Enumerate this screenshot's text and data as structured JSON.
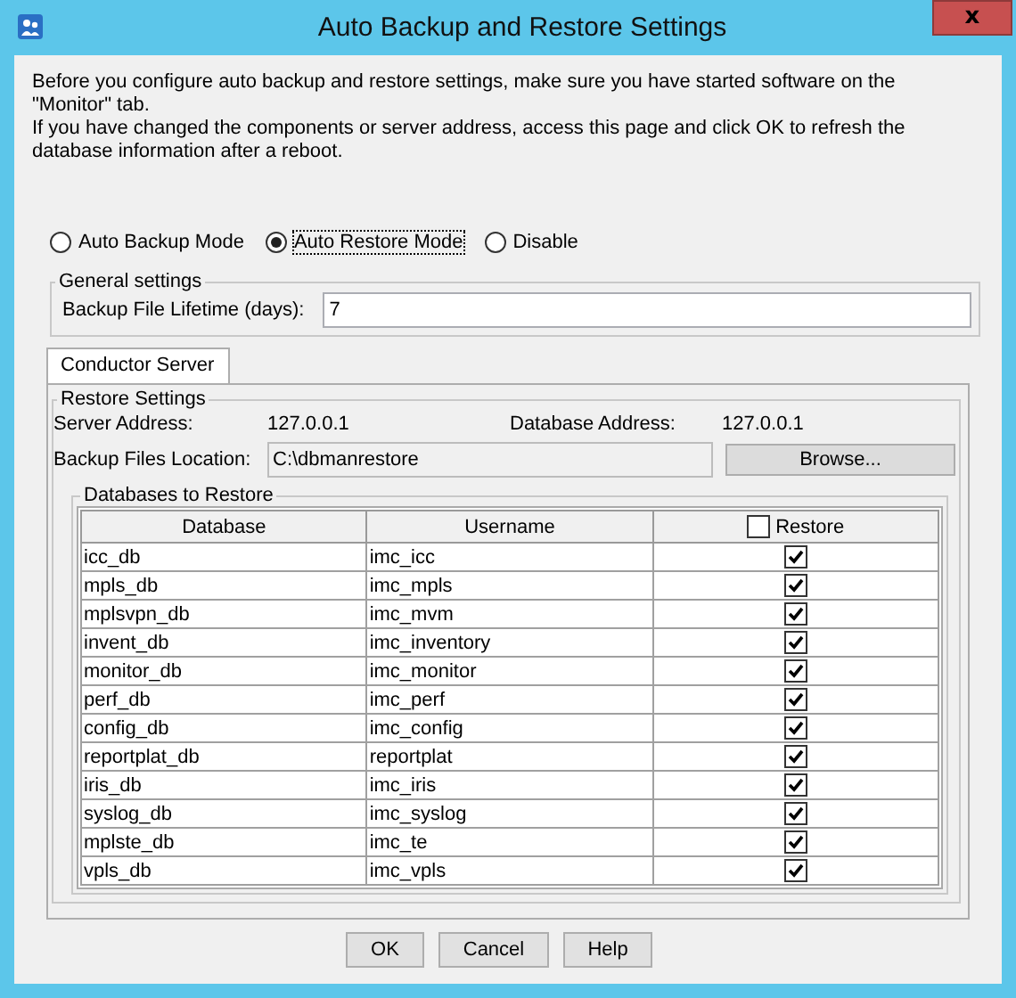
{
  "window": {
    "title": "Auto Backup and Restore Settings",
    "close": "x"
  },
  "intro": [
    "Before you configure auto backup and restore settings, make sure you have started software on the \"Monitor\" tab.",
    "If you have changed the components or server address, access this page and click OK to refresh the database information after a reboot."
  ],
  "modes": [
    {
      "label": "Auto Backup Mode",
      "selected": false
    },
    {
      "label": "Auto Restore Mode",
      "selected": true
    },
    {
      "label": "Disable",
      "selected": false
    }
  ],
  "general_settings": {
    "title": "General settings",
    "lifetime_label": "Backup File Lifetime (days):",
    "lifetime_value": "7"
  },
  "tabs": [
    {
      "label": "Conductor Server",
      "selected": true
    }
  ],
  "restore_settings": {
    "title": "Restore Settings",
    "server_address_label": "Server Address:",
    "server_address": "127.0.0.1",
    "database_address_label": "Database Address:",
    "database_address": "127.0.0.1",
    "location_label": "Backup Files Location:",
    "location_value": "C:\\dbmanrestore",
    "browse_button": "Browse..."
  },
  "databases": {
    "title": "Databases to Restore",
    "columns": [
      {
        "label": "Database",
        "kind": "text"
      },
      {
        "label": "Username",
        "kind": "text"
      },
      {
        "label": "Restore",
        "kind": "check",
        "checked": false
      }
    ],
    "rows": [
      {
        "database": "icc_db",
        "username": "imc_icc",
        "restore": true
      },
      {
        "database": "mpls_db",
        "username": "imc_mpls",
        "restore": true
      },
      {
        "database": "mplsvpn_db",
        "username": "imc_mvm",
        "restore": true
      },
      {
        "database": "invent_db",
        "username": "imc_inventory",
        "restore": true
      },
      {
        "database": "monitor_db",
        "username": "imc_monitor",
        "restore": true
      },
      {
        "database": "perf_db",
        "username": "imc_perf",
        "restore": true
      },
      {
        "database": "config_db",
        "username": "imc_config",
        "restore": true
      },
      {
        "database": "reportplat_db",
        "username": "reportplat",
        "restore": true
      },
      {
        "database": "iris_db",
        "username": "imc_iris",
        "restore": true
      },
      {
        "database": "syslog_db",
        "username": "imc_syslog",
        "restore": true
      },
      {
        "database": "mplste_db",
        "username": "imc_te",
        "restore": true
      },
      {
        "database": "vpls_db",
        "username": "imc_vpls",
        "restore": true
      }
    ]
  },
  "buttons": [
    "OK",
    "Cancel",
    "Help"
  ]
}
